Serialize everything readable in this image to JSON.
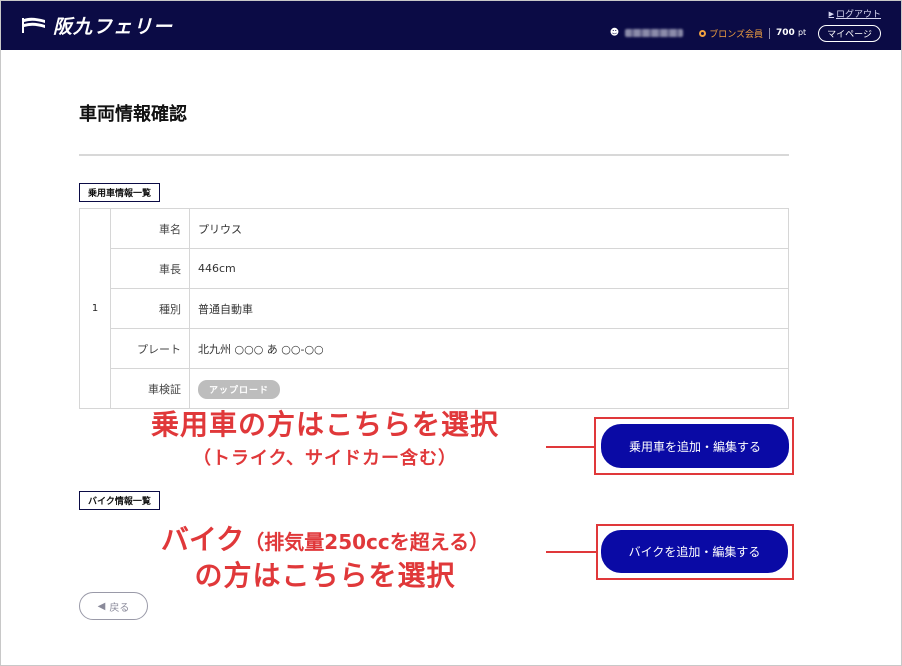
{
  "header": {
    "logo_text": "阪九フェリー",
    "logout_label": "ログアウト",
    "rank_label": "ブロンズ会員",
    "points_value": "700",
    "points_unit": "pt",
    "mypage_label": "マイページ"
  },
  "main": {
    "page_title": "車両情報確認",
    "car_section_label": "乗用車情報一覧",
    "bike_section_label": "バイク情報一覧",
    "vehicle": {
      "index": "1",
      "rows": [
        {
          "key": "車名",
          "value": "プリウス"
        },
        {
          "key": "車長",
          "value": "446cm"
        },
        {
          "key": "種別",
          "value": "普通自動車"
        },
        {
          "key": "プレート",
          "value": "北九州 ○○○ あ ○○-○○"
        },
        {
          "key": "車検証",
          "value": "アップロード"
        }
      ]
    },
    "car_button_label": "乗用車を追加・編集する",
    "bike_button_label": "バイクを追加・編集する",
    "back_label": "戻る"
  },
  "annotations": {
    "car_main": "乗用車の方はこちらを選択",
    "car_sub": "（トライク、サイドカー含む）",
    "bike_main_lead": "バイク",
    "bike_main_paren": "（排気量250ccを超える）",
    "bike_sub": "の方はこちらを選択"
  },
  "colors": {
    "header_bg": "#0b0b45",
    "button_blue": "#0a0aa5",
    "annotation_red": "#e0383a",
    "rank_orange": "#f0a040"
  }
}
